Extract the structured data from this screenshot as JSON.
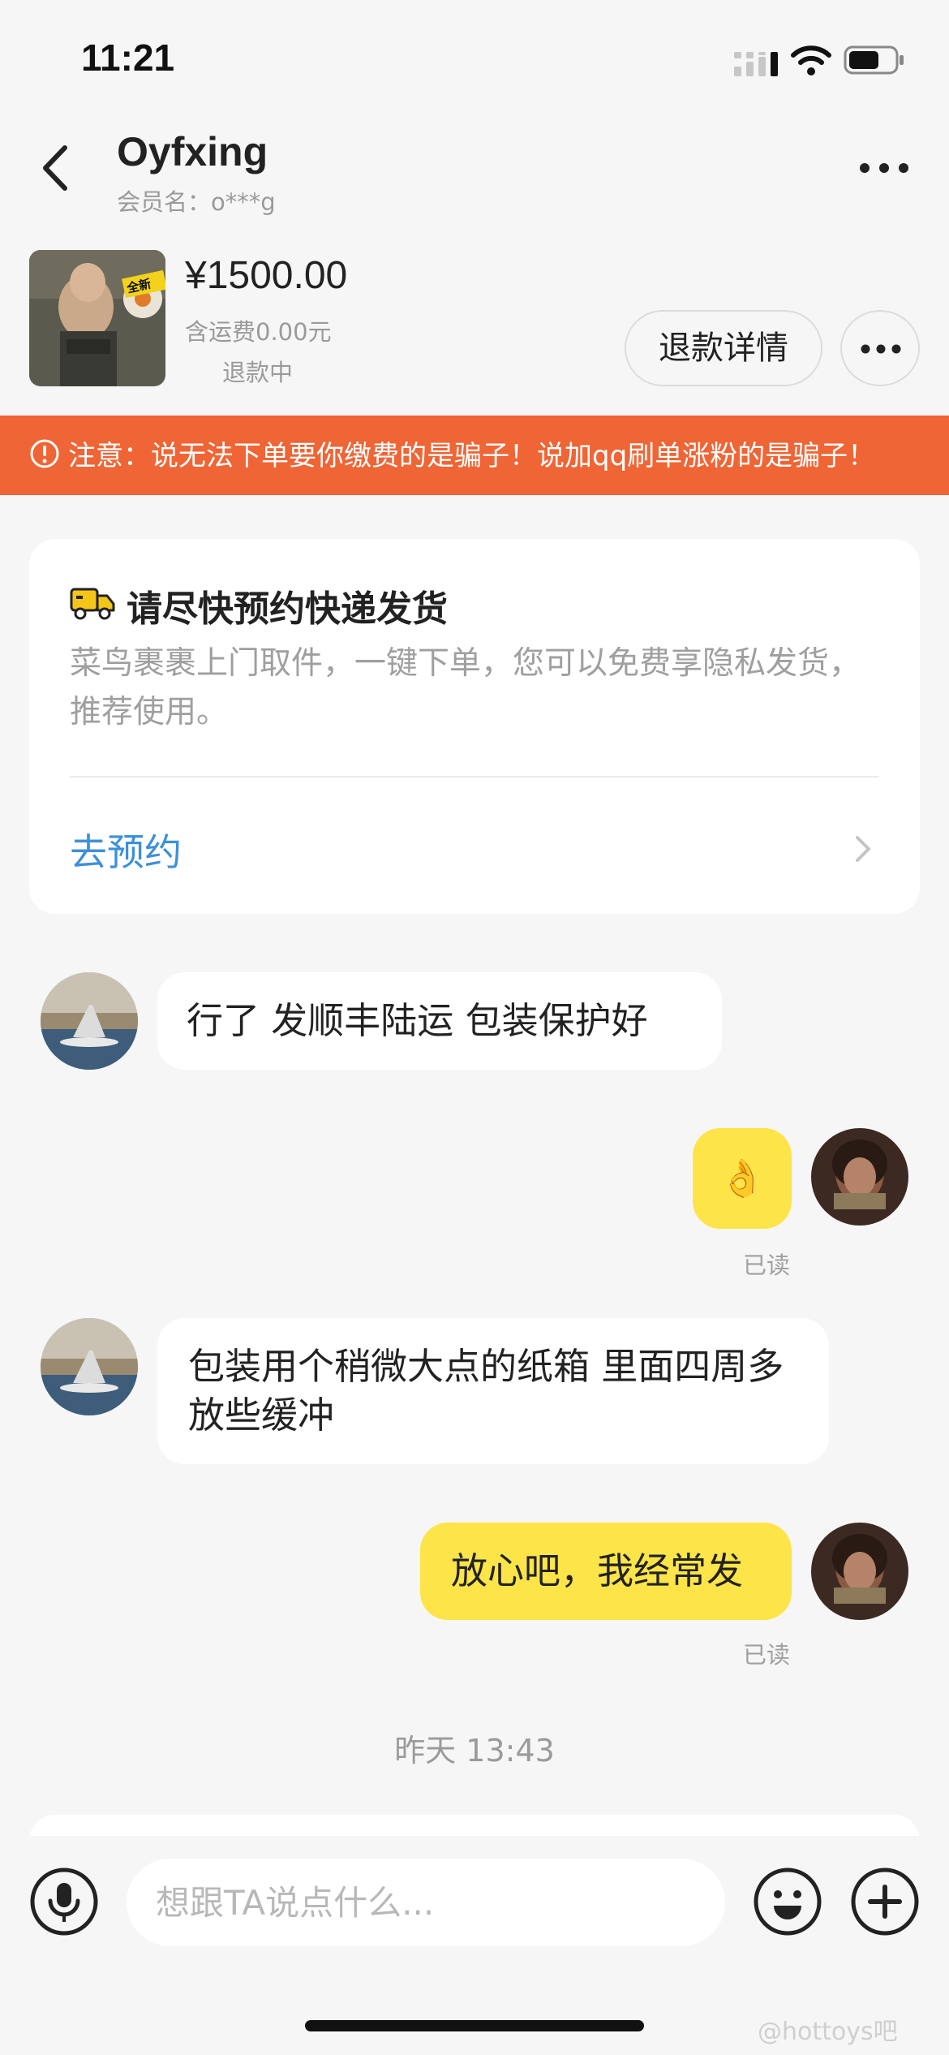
{
  "status_bar": {
    "time": "11:21"
  },
  "header": {
    "name": "Oyfxing",
    "member": "会员名：o***g"
  },
  "order": {
    "price": "¥1500.00",
    "shipping": "含运费0.00元",
    "status": "退款中",
    "refund_button": "退款详情",
    "thumb_badge": "全新"
  },
  "warning": {
    "text": "注意：说无法下单要你缴费的是骗子！说加qq刷单涨粉的是骗子！"
  },
  "ship_card": {
    "title": "请尽快预约快递发货",
    "desc": "菜鸟裹裹上门取件，一键下单，您可以免费享隐私发货，推荐使用。",
    "link": "去预约"
  },
  "messages": [
    {
      "side": "left",
      "text": "行了 发顺丰陆运  包装保护好"
    },
    {
      "side": "right",
      "text": "👌",
      "read": "已读"
    },
    {
      "side": "left",
      "text": "包装用个稍微大点的纸箱 里面四周多放些缓冲"
    },
    {
      "side": "right",
      "text": "放心吧，我经常发",
      "read": "已读"
    }
  ],
  "time_divider": "昨天 13:43",
  "input": {
    "placeholder": "想跟TA说点什么..."
  },
  "watermark": "@hottoys吧",
  "colors": {
    "warning": "#ef6535",
    "bubble_right": "#fce449",
    "link": "#3e8fd9",
    "background": "#f6f6f6"
  }
}
